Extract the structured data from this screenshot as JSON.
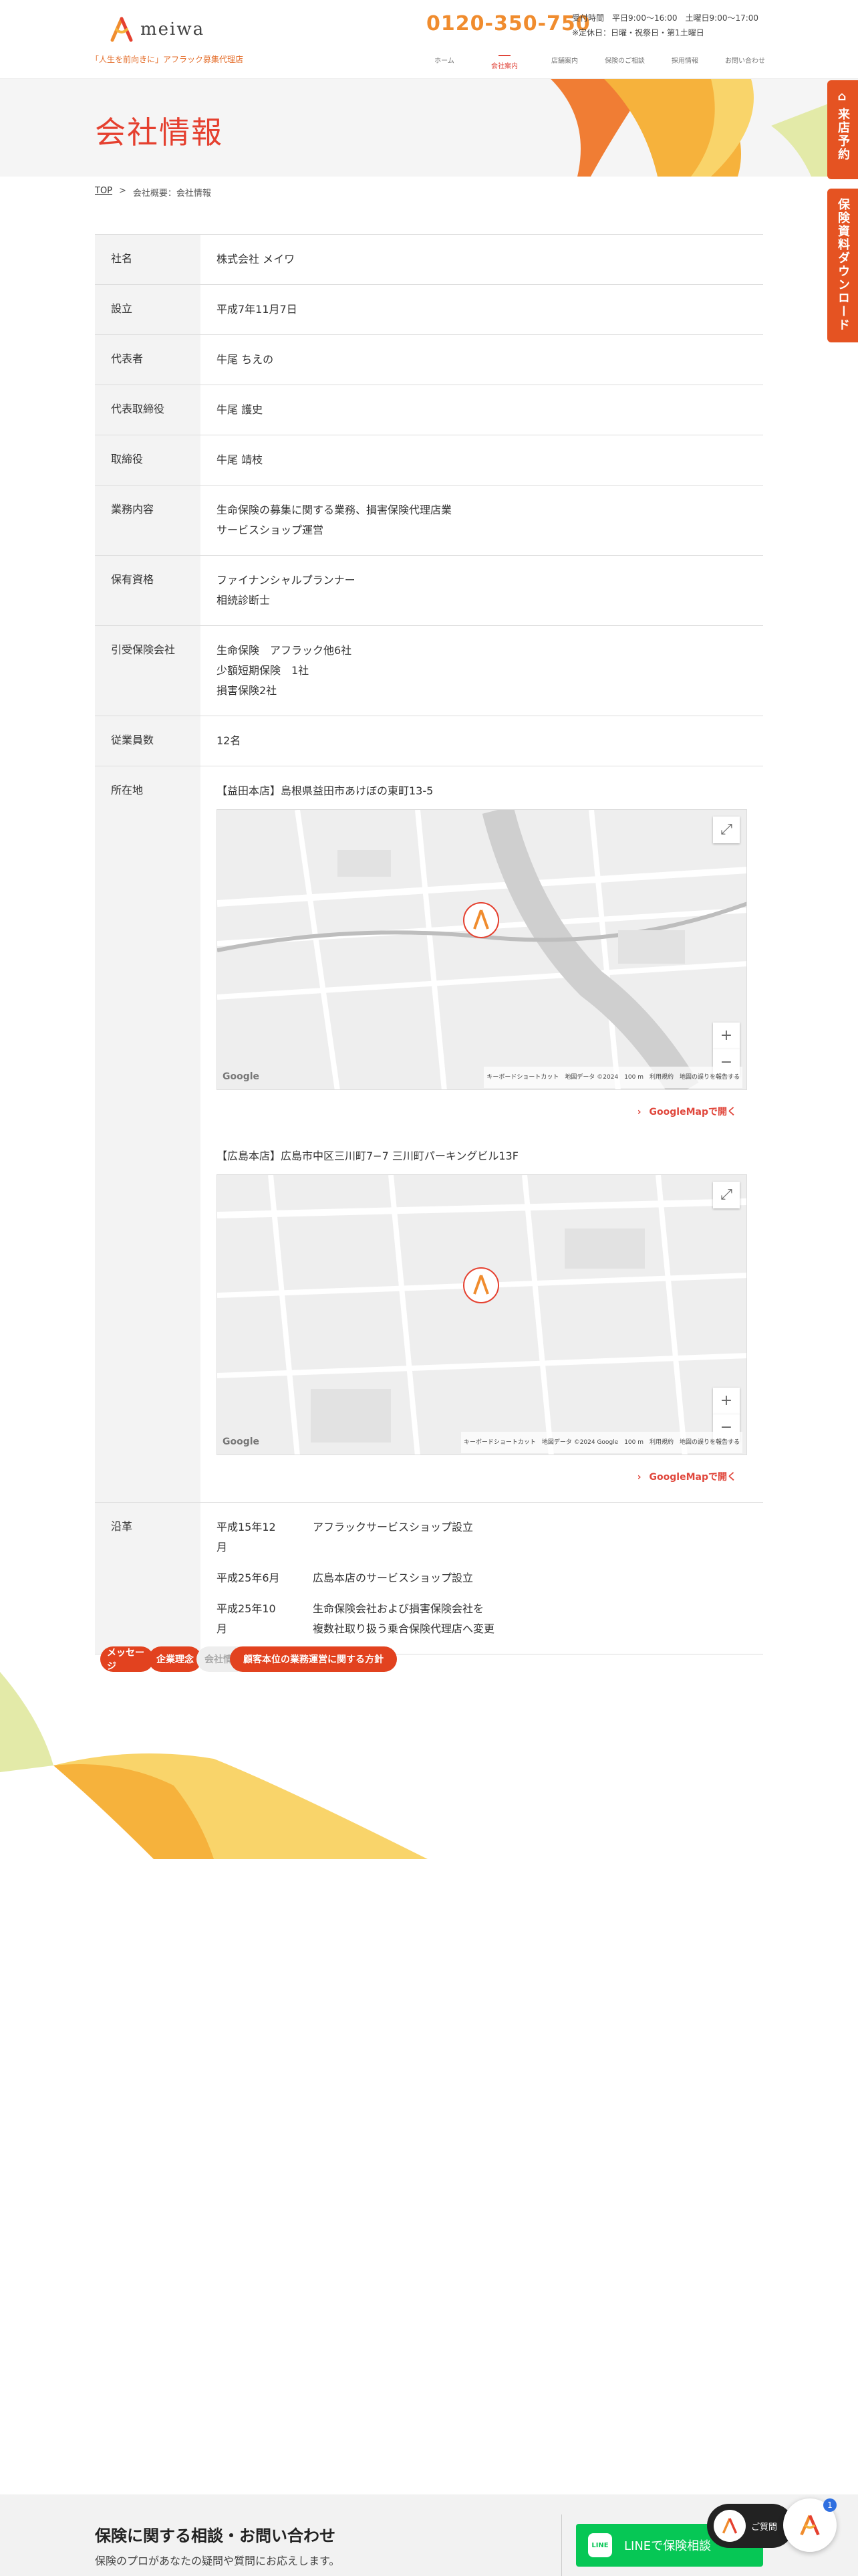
{
  "header": {
    "logo_text": "meiwa",
    "tagline": "「人生を前向きに」アフラック募集代理店",
    "phone": "0120-350-750",
    "hours_line1": "受付時間　平日9:00～16:00　土曜日9:00～17:00",
    "hours_line2": "※定休日：日曜・祝祭日・第1土曜日",
    "nav": [
      "ホーム",
      "会社案内",
      "店舗案内",
      "保険のご相談",
      "採用情報",
      "お問い合わせ"
    ]
  },
  "hero": {
    "title": "会社情報"
  },
  "side_tabs": {
    "visit": "来店予約",
    "download": "保険資料ダウンロード"
  },
  "breadcrumb": {
    "top": "TOP",
    "separator": ">",
    "current": "会社概要：会社情報"
  },
  "company": {
    "rows": [
      {
        "label": "社名",
        "lines": [
          "株式会社 メイワ"
        ]
      },
      {
        "label": "設立",
        "lines": [
          "平成7年11月7日"
        ]
      },
      {
        "label": "代表者",
        "lines": [
          "牛尾 ちえの"
        ]
      },
      {
        "label": "代表取締役",
        "lines": [
          "牛尾 護史"
        ]
      },
      {
        "label": "取締役",
        "lines": [
          "牛尾 靖枝"
        ]
      },
      {
        "label": "業務内容",
        "lines": [
          "生命保険の募集に関する業務、損害保険代理店業",
          "サービスショップ運営"
        ]
      },
      {
        "label": "保有資格",
        "lines": [
          "ファイナンシャルプランナー",
          "相続診断士"
        ]
      },
      {
        "label": "引受保険会社",
        "lines": [
          "生命保険　アフラック他6社",
          "少額短期保険　1社",
          "損害保険2社"
        ]
      },
      {
        "label": "従業員数",
        "lines": [
          "12名"
        ]
      }
    ],
    "location_label": "所在地",
    "locations": [
      {
        "title": "【益田本店】島根県益田市あけぼの東町13-5",
        "link": "GoogleMapで開く",
        "map_footer": "キーボードショートカット　地図データ ©2024　100 m　利用規約　地図の誤りを報告する"
      },
      {
        "title": "【広島本店】広島市中区三川町7−7 三川町パーキングビル13F",
        "link": "GoogleMapで開く",
        "map_footer": "キーボードショートカット　地図データ ©2024 Google　100 m　利用規約　地図の誤りを報告する"
      }
    ],
    "history_label": "沿革",
    "history": [
      {
        "date": "平成15年12月",
        "lines": [
          "アフラックサービスショップ設立"
        ]
      },
      {
        "date": "平成25年6月",
        "lines": [
          "広島本店のサービスショップ設立"
        ]
      },
      {
        "date": "平成25年10月",
        "lines": [
          "生命保険会社および損害保険会社を",
          "複数社取り扱う乗合保険代理店へ変更"
        ]
      }
    ]
  },
  "page_buttons": [
    "メッセージ",
    "企業理念",
    "会社情報",
    "顧客本位の業務運営に関する方針"
  ],
  "contact": {
    "title": "保険に関する相談・お問い合わせ",
    "sub": "保険のプロがあなたの疑問や質問にお応えします。",
    "line_button": "LINEで保険相談",
    "line_icon": "LINE",
    "chat_label": "ご質問",
    "chat_badge": "1"
  },
  "colors": {
    "accent": "#e5402f",
    "orange": "#f08c2e",
    "line_green": "#06c755"
  }
}
